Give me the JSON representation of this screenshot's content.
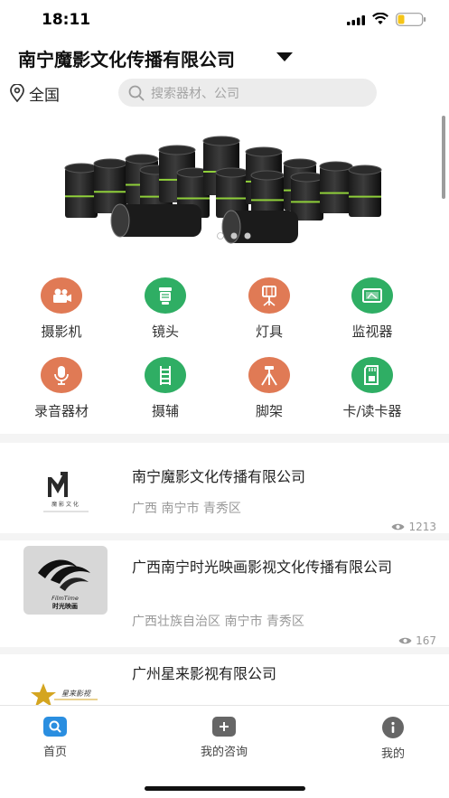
{
  "status": {
    "time": "18:11",
    "battery_color": "#f5c518"
  },
  "header": {
    "company_title": "南宁魔影文化传播有限公司",
    "dropdown_icon": "triangle-down",
    "location": "全国",
    "search_placeholder": "搜索器材、公司"
  },
  "banner": {
    "slide_count": 3,
    "active_slide": 0
  },
  "categories": [
    {
      "label": "摄影机",
      "icon": "camera-icon",
      "color": "#e07a55"
    },
    {
      "label": "镜头",
      "icon": "lens-icon",
      "color": "#2fae64"
    },
    {
      "label": "灯具",
      "icon": "light-icon",
      "color": "#e07a55"
    },
    {
      "label": "监视器",
      "icon": "monitor-icon",
      "color": "#2fae64"
    },
    {
      "label": "录音器材",
      "icon": "microphone-icon",
      "color": "#e07a55"
    },
    {
      "label": "摄辅",
      "icon": "ladder-icon",
      "color": "#2fae64"
    },
    {
      "label": "脚架",
      "icon": "tripod-icon",
      "color": "#e07a55"
    },
    {
      "label": "卡/读卡器",
      "icon": "sd-card-icon",
      "color": "#2fae64"
    }
  ],
  "companies": [
    {
      "name": "南宁魔影文化传播有限公司",
      "location": "广西 南宁市 青秀区",
      "views": "1213",
      "logo_text": "魔 影 文 化"
    },
    {
      "name": "广西南宁时光映画影视文化传播有限公司",
      "location": "广西壮族自治区 南宁市 青秀区",
      "views": "167",
      "logo_text": "FilmTime",
      "logo_subtext": "时光映画"
    },
    {
      "name": "广州星来影视有限公司",
      "logo_text": "星来影视"
    }
  ],
  "tabs": [
    {
      "label": "首页",
      "icon": "search-icon",
      "color": "#2a8ee0"
    },
    {
      "label": "我的咨询",
      "icon": "plus-icon",
      "color": "#666666"
    },
    {
      "label": "我的",
      "icon": "info-icon",
      "color": "#666666"
    }
  ]
}
